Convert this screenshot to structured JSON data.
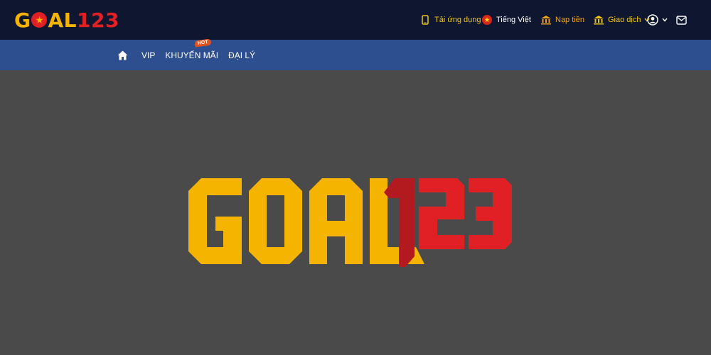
{
  "brand": {
    "logo_text_goal": "GOAL",
    "logo_text_num": "123",
    "colors": {
      "gold": "#f4b400",
      "red": "#e02024",
      "topbar": "#0f1730",
      "navbar": "#2d4f8f",
      "background": "#4a4a4a"
    }
  },
  "topbar": {
    "app": {
      "label": "Tải ứng dụng",
      "icon": "phone-icon"
    },
    "language": {
      "label": "Tiếng Việt",
      "icon": "vietnam-flag-icon"
    },
    "deposit": {
      "label": "Nạp tiền",
      "icon": "bank-icon"
    },
    "transactions": {
      "label": "Giao dịch",
      "icon": "bank-icon"
    },
    "user": {
      "icon": "user-icon"
    },
    "mail": {
      "icon": "mail-icon"
    }
  },
  "nav": {
    "home_icon": "home-icon",
    "items": [
      {
        "label": "VIP"
      },
      {
        "label": "KHUYẾN MÃI",
        "badge": "HOT"
      },
      {
        "label": "ĐẠI LÝ"
      }
    ]
  },
  "hero": {
    "logo_goal": "GOAL",
    "logo_num": "123"
  }
}
